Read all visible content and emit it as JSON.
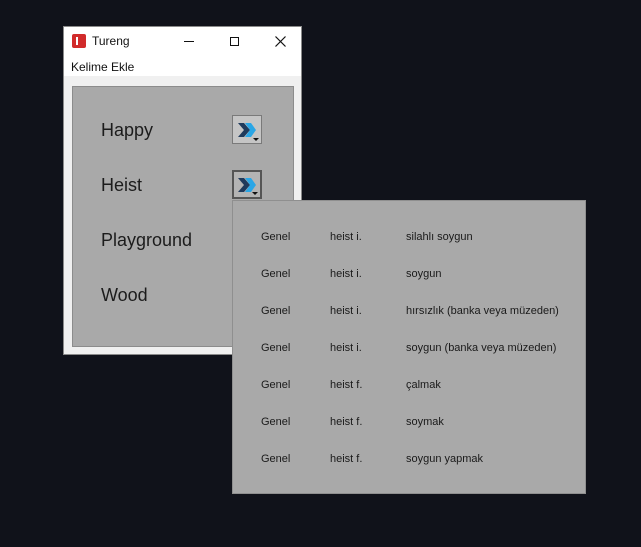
{
  "window": {
    "title": "Tureng",
    "menu": [
      "Kelime Ekle"
    ]
  },
  "words": [
    {
      "label": "Happy",
      "has_button": true
    },
    {
      "label": "Heist",
      "has_button": true,
      "pressed": true
    },
    {
      "label": "Playground",
      "has_button": false
    },
    {
      "label": "Wood",
      "has_button": false
    }
  ],
  "translations": [
    {
      "category": "Genel",
      "term": "heist i.",
      "meaning": "silahlı soygun"
    },
    {
      "category": "Genel",
      "term": "heist i.",
      "meaning": "soygun"
    },
    {
      "category": "Genel",
      "term": "heist i.",
      "meaning": "hırsızlık (banka veya müzeden)"
    },
    {
      "category": "Genel",
      "term": "heist i.",
      "meaning": "soygun (banka veya müzeden)"
    },
    {
      "category": "Genel",
      "term": "heist f.",
      "meaning": "çalmak"
    },
    {
      "category": "Genel",
      "term": "heist f.",
      "meaning": "soymak"
    },
    {
      "category": "Genel",
      "term": "heist f.",
      "meaning": "soygun yapmak"
    }
  ],
  "colors": {
    "arrow_dark": "#1f3a5c",
    "arrow_light": "#2aa6e6"
  },
  "icons": {
    "app": "tureng-logo-icon",
    "minimize": "minimize-icon",
    "maximize": "maximize-icon",
    "close": "close-icon",
    "lookup": "double-chevron-right-icon"
  }
}
